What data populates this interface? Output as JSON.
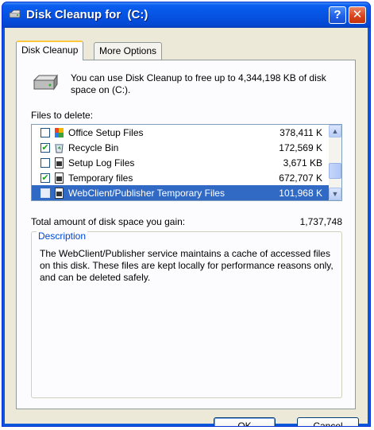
{
  "window": {
    "title": "Disk Cleanup for  (C:)",
    "help_glyph": "?",
    "close_glyph": "✕"
  },
  "tabs": [
    {
      "label": "Disk Cleanup",
      "active": true
    },
    {
      "label": "More Options",
      "active": false
    }
  ],
  "intro_text": "You can use Disk Cleanup to free up to 4,344,198 KB of disk space on  (C:).",
  "files_label": "Files to delete:",
  "files": [
    {
      "name": "Office Setup Files",
      "size": "378,411 K",
      "checked": false,
      "icon": "office-setup-icon"
    },
    {
      "name": "Recycle Bin",
      "size": "172,569 K",
      "checked": true,
      "icon": "recycle-bin-icon"
    },
    {
      "name": "Setup Log Files",
      "size": "3,671 KB",
      "checked": false,
      "icon": "file-icon"
    },
    {
      "name": "Temporary files",
      "size": "672,707 K",
      "checked": true,
      "icon": "file-icon"
    },
    {
      "name": "WebClient/Publisher Temporary Files",
      "size": "101,968 K",
      "checked": false,
      "selected": true,
      "icon": "file-icon"
    }
  ],
  "check_glyph": "✔",
  "total_label": "Total amount of disk space you gain:",
  "total_value": "1,737,748",
  "description": {
    "legend": "Description",
    "text": "The WebClient/Publisher service maintains a cache of accessed files on this disk. These files are kept locally for performance reasons only, and can be deleted safely."
  },
  "buttons": {
    "ok": "OK",
    "cancel": "Cancel"
  },
  "colors": {
    "titlebar": "#0654e4",
    "selection": "#316ac5",
    "dialog_bg": "#ece9d8",
    "legend": "#0046d5"
  }
}
